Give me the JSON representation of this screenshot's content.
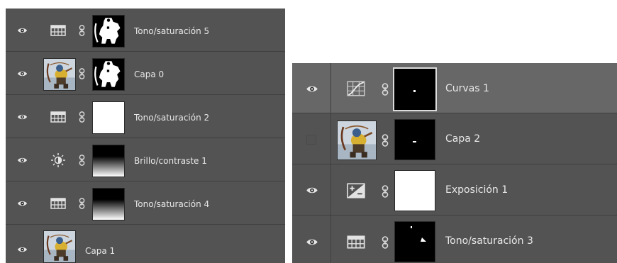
{
  "left_panel": {
    "layers": [
      {
        "name": "Tono/saturación 5",
        "type": "hue-saturation-icon",
        "mask": "character-silhouette-mask",
        "visible": true
      },
      {
        "name": "Capa 0",
        "type": "image-thumbnail",
        "mask": "character-silhouette-mask",
        "visible": true
      },
      {
        "name": "Tono/saturación 2",
        "type": "hue-saturation-icon",
        "mask": "white-mask",
        "visible": true
      },
      {
        "name": "Brillo/contraste 1",
        "type": "brightness-contrast-icon",
        "mask": "gradient-mask",
        "visible": true
      },
      {
        "name": "Tono/saturación 4",
        "type": "hue-saturation-icon",
        "mask": "gradient-mask",
        "visible": true
      },
      {
        "name": "Capa 1",
        "type": "image-thumbnail",
        "mask": "none",
        "visible": true
      }
    ]
  },
  "right_panel": {
    "layers": [
      {
        "name": "Curvas 1",
        "type": "curves-icon",
        "mask": "black-mask-dot",
        "visible": true,
        "selected": true
      },
      {
        "name": "Capa 2",
        "type": "image-thumbnail",
        "mask": "black-mask-dash",
        "visible": false
      },
      {
        "name": "Exposición 1",
        "type": "exposure-icon",
        "mask": "white-mask",
        "visible": true
      },
      {
        "name": "Tono/saturación 3",
        "type": "hue-saturation-icon",
        "mask": "black-mask-shapes",
        "visible": true
      }
    ]
  },
  "colors": {
    "panel_bg": "#535353",
    "selected_row": "#676767",
    "divider": "#3f3f3f",
    "text": "#e8e8e8"
  }
}
